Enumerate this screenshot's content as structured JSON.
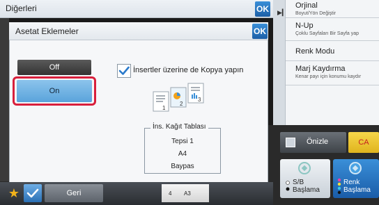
{
  "topbar": {
    "title": "Diğerleri",
    "ok_label": "OK"
  },
  "right_panel": {
    "items": [
      {
        "title": "Orjinal",
        "subtitle": "Boyut/Yön Değiştir"
      },
      {
        "title": "N-Up",
        "subtitle": "Çoklu Sayfaları Bir Sayfa yap"
      },
      {
        "title": "Renk Modu",
        "subtitle": ""
      },
      {
        "title": "Marj Kaydırma",
        "subtitle": "Kenar payı için konumu kaydır"
      }
    ]
  },
  "dialog": {
    "title": "Asetat Eklemeler",
    "ok_label": "OK",
    "off_label": "Off",
    "on_label": "On",
    "selected": "On",
    "copy_checkbox_label": "İnsertler üzerine de Kopya yapın",
    "copy_checkbox_checked": true,
    "tray": {
      "title": "İns. Kağıt Tablası",
      "values": [
        "Tepsi 1",
        "A4",
        "Baypas"
      ]
    }
  },
  "bottom_bar": {
    "back_label": "Geri",
    "status_copies": "4",
    "status_size": "A3"
  },
  "controls": {
    "preview_label": "Önizle",
    "ca_label": "CA",
    "bw_label_line1": "S/B",
    "bw_label_line2": "Başlama",
    "color_label_line1": "Renk",
    "color_label_line2": "Başlama"
  },
  "colors": {
    "accent_blue": "#2a7acb",
    "highlight_red": "#d81f3c",
    "ca_yellow": "#f0c834"
  }
}
